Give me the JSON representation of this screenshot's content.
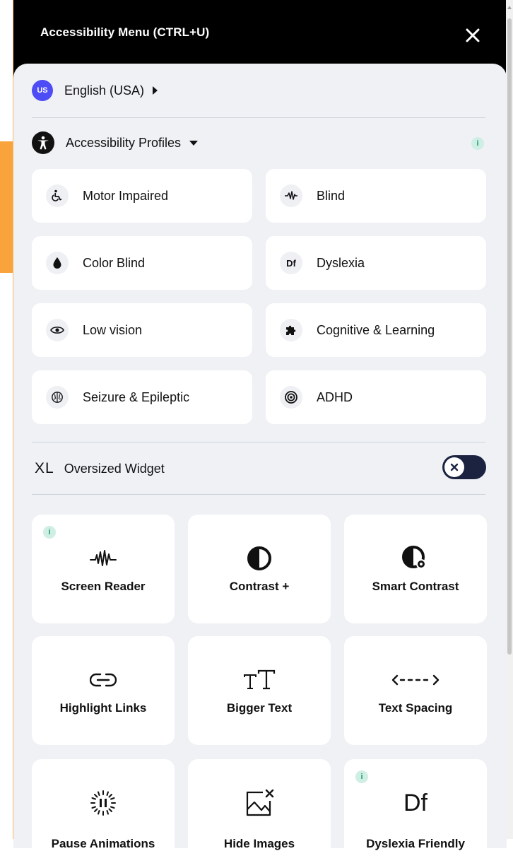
{
  "header": {
    "title": "Accessibility Menu (CTRL+U)"
  },
  "language": {
    "flag": "US",
    "label": "English (USA)"
  },
  "profiles": {
    "title": "Accessibility Profiles",
    "info": "i",
    "items": [
      {
        "label": "Motor Impaired",
        "icon": "wheelchair-icon"
      },
      {
        "label": "Blind",
        "icon": "sound-wave-icon"
      },
      {
        "label": "Color Blind",
        "icon": "droplet-icon"
      },
      {
        "label": "Dyslexia",
        "icon": "dyslexia-df-icon",
        "glyph": "Df"
      },
      {
        "label": "Low vision",
        "icon": "eye-icon"
      },
      {
        "label": "Cognitive & Learning",
        "icon": "puzzle-icon"
      },
      {
        "label": "Seizure & Epileptic",
        "icon": "brain-icon"
      },
      {
        "label": "ADHD",
        "icon": "target-icon"
      }
    ]
  },
  "oversized": {
    "mark": "XL",
    "label": "Oversized Widget",
    "enabled": false
  },
  "features": [
    {
      "label": "Screen Reader",
      "icon": "screen-reader-wave-icon",
      "info": "i"
    },
    {
      "label": "Contrast +",
      "icon": "contrast-icon"
    },
    {
      "label": "Smart Contrast",
      "icon": "smart-contrast-icon"
    },
    {
      "label": "Highlight Links",
      "icon": "link-icon"
    },
    {
      "label": "Bigger Text",
      "icon": "text-size-icon",
      "glyph": "TT"
    },
    {
      "label": "Text Spacing",
      "icon": "text-spacing-icon",
      "glyph": "<--->"
    },
    {
      "label": "Pause Animations",
      "icon": "pause-animation-icon"
    },
    {
      "label": "Hide Images",
      "icon": "hide-image-icon"
    },
    {
      "label": "Dyslexia Friendly",
      "icon": "dyslexia-df-icon",
      "glyph": "Df",
      "info": "i"
    }
  ],
  "colors": {
    "header": "#000000",
    "sheet": "#eff1f5",
    "accent_orange": "#f8a33b",
    "flag_blue": "#4e4cf5",
    "toggle": "#1b2340",
    "info": "#1e9c73"
  }
}
